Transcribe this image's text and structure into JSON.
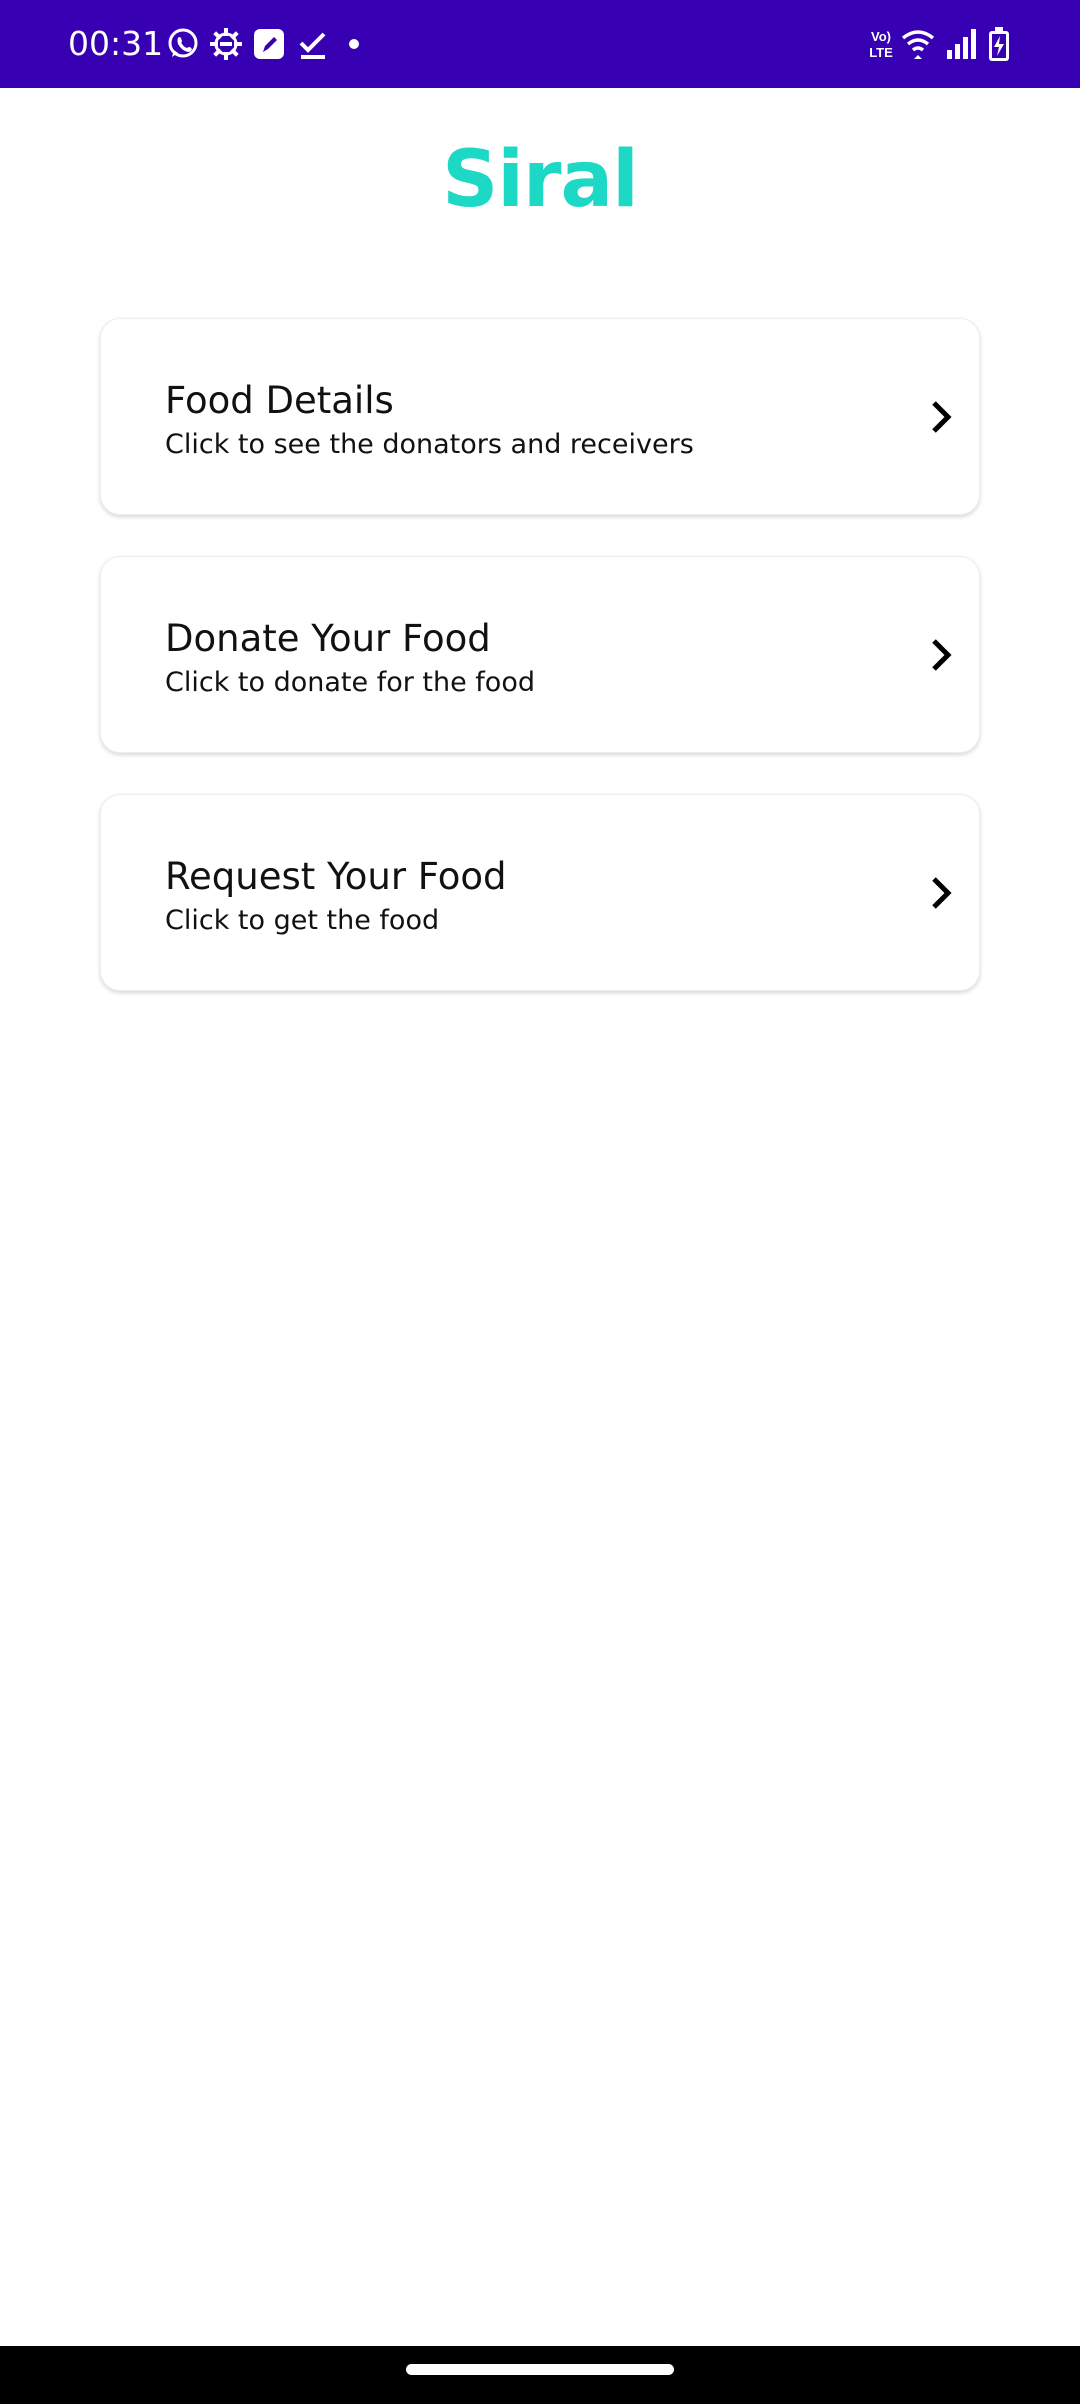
{
  "status_bar": {
    "time": "00:31",
    "left_icons": [
      "whatsapp-icon",
      "gear-badge-icon",
      "note-edit-icon",
      "check-download-icon",
      "dot-icon"
    ],
    "right_icons": [
      "volte-lte-icon",
      "wifi-icon",
      "signal-icon",
      "battery-charging-icon"
    ],
    "volte_top": "Vo)",
    "volte_bottom": "LTE",
    "background_color": "#3700b3"
  },
  "app": {
    "title": "Siral",
    "title_color": "#1ed8c6"
  },
  "menu": {
    "items": [
      {
        "title": "Food Details",
        "subtitle": "Click to see the donators and receivers",
        "icon": "chevron-right-icon"
      },
      {
        "title": "Donate Your Food",
        "subtitle": "Click to donate for the food",
        "icon": "chevron-right-icon"
      },
      {
        "title": "Request Your Food",
        "subtitle": "Click to get the food",
        "icon": "chevron-right-icon"
      }
    ]
  },
  "nav_bar": {
    "background_color": "#000000",
    "handle": "home-gesture-handle"
  }
}
